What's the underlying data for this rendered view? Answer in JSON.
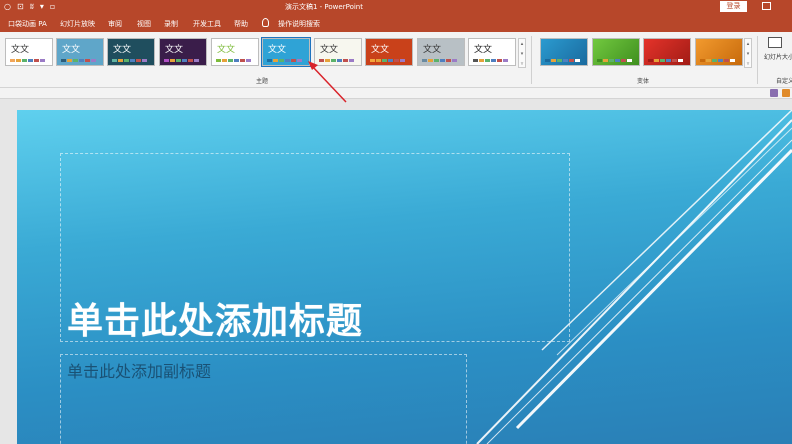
{
  "window": {
    "title": "演示文稿1 - PowerPoint",
    "login_label": "登录",
    "qat": [
      "○",
      "⊡",
      "ʬ",
      "▾",
      "▫"
    ]
  },
  "menu": {
    "tabs": [
      "口袋动画 PA",
      "幻灯片放映",
      "审阅",
      "视图",
      "录制",
      "开发工具",
      "帮助",
      "操作说明搜索"
    ]
  },
  "ribbon": {
    "themes_group_label": "主题",
    "variants_group_label": "变体",
    "slide_size_label": "幻灯片大小",
    "customize_group_label": "自定义",
    "themes": [
      {
        "text": "文文",
        "bg": "#ffffff",
        "fg": "#333333",
        "accent": "#f2a65a"
      },
      {
        "text": "文文",
        "bg": "#5fa6c9",
        "fg": "#ffffff",
        "accent": "#2c5d7a"
      },
      {
        "text": "文文",
        "bg": "#1f4e5e",
        "fg": "#ffffff",
        "accent": "#61b3a1"
      },
      {
        "text": "文文",
        "bg": "#3a1d4a",
        "fg": "#ffffff",
        "accent": "#b14fc5"
      },
      {
        "text": "文文",
        "bg": "#ffffff",
        "fg": "#7dbb3a",
        "accent": "#7dbb3a"
      },
      {
        "text": "文文",
        "bg": "#2fa3d6",
        "fg": "#ffffff",
        "accent": "#1c6fa3"
      },
      {
        "text": "文文",
        "bg": "#f7f7ef",
        "fg": "#333333",
        "accent": "#c0504d"
      },
      {
        "text": "文文",
        "bg": "#c9411a",
        "fg": "#ffffff",
        "accent": "#f3a53a"
      },
      {
        "text": "文文",
        "bg": "#b8c0c5",
        "fg": "#333333",
        "accent": "#6a8aa0"
      },
      {
        "text": "文文",
        "bg": "#ffffff",
        "fg": "#222222",
        "accent": "#555555"
      }
    ],
    "selected_theme_index": 5,
    "variants": [
      {
        "bg": "#2b9bd0",
        "accent": "#1a6a9e"
      },
      {
        "bg": "#72c93f",
        "accent": "#3f8f1f"
      },
      {
        "bg": "#e5332a",
        "accent": "#a11c16"
      },
      {
        "bg": "#f29a2e",
        "accent": "#c76a0c"
      }
    ]
  },
  "slide": {
    "title_placeholder": "单击此处添加标题",
    "subtitle_placeholder": "单击此处添加副标题"
  }
}
